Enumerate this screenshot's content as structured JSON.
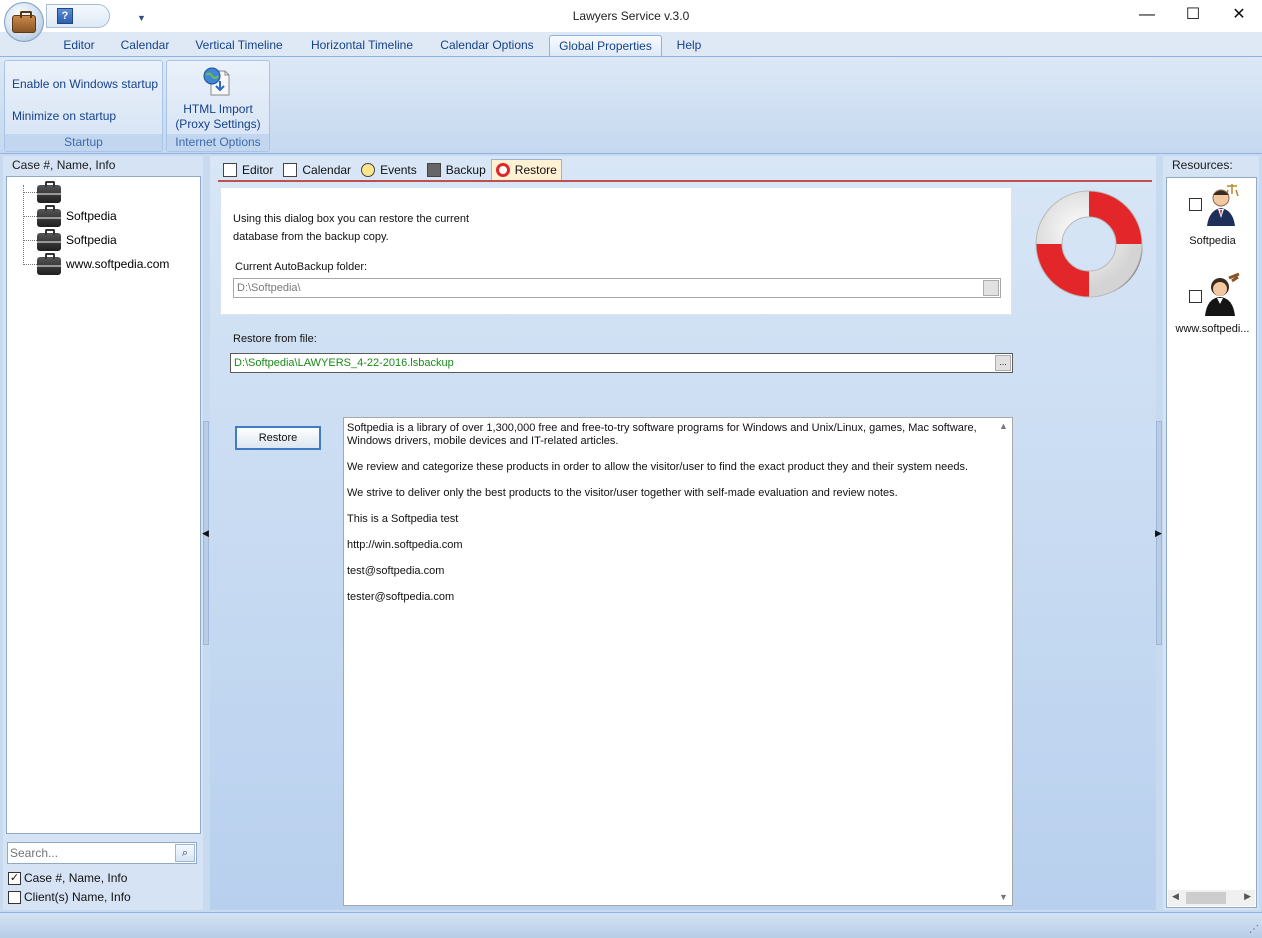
{
  "window": {
    "title": "Lawyers Service v.3.0",
    "min": "—",
    "max": "☐",
    "close": "✕",
    "help_glyph": "?",
    "qat_arrow": "▼"
  },
  "ribbon": {
    "tabs": [
      {
        "label": "Editor"
      },
      {
        "label": "Calendar"
      },
      {
        "label": "Vertical Timeline"
      },
      {
        "label": "Horizontal Timeline"
      },
      {
        "label": "Calendar Options"
      },
      {
        "label": "Global Properties"
      },
      {
        "label": "Help"
      }
    ],
    "active_tab": "Global Properties",
    "startup_group": {
      "label": "Startup",
      "enable_startup": "Enable on Windows startup",
      "minimize_startup": "Minimize on startup"
    },
    "internet_group": {
      "label": "Internet Options",
      "html_import_line1": "HTML Import",
      "html_import_line2": "(Proxy Settings)"
    }
  },
  "left_panel": {
    "header": "Case #, Name, Info",
    "tree_items": [
      {
        "label": ""
      },
      {
        "label": "Softpedia"
      },
      {
        "label": "Softpedia"
      },
      {
        "label": "www.softpedia.com"
      }
    ],
    "search_placeholder": "Search...",
    "search_btn": "⌕",
    "filter_case": {
      "label": "Case #, Name, Info",
      "checked": true
    },
    "filter_client": {
      "label": "Client(s) Name, Info",
      "checked": false
    }
  },
  "main": {
    "tabs": [
      {
        "label": "Editor"
      },
      {
        "label": "Calendar"
      },
      {
        "label": "Events"
      },
      {
        "label": "Backup"
      },
      {
        "label": "Restore"
      }
    ],
    "active_tab": "Restore",
    "description_line1": "Using this dialog box you can restore the current",
    "description_line2": "database from the backup copy.",
    "autobackup_label": "Current AutoBackup folder:",
    "autobackup_value": "D:\\Softpedia\\",
    "restore_from_label": "Restore from file:",
    "restore_from_value": "D:\\Softpedia\\LAWYERS_4-22-2016.lsbackup",
    "browse_btn": "...",
    "restore_button": "Restore",
    "notes": [
      "Softpedia is a library of over 1,300,000 free and free-to-try software programs for Windows and Unix/Linux, games, Mac software, Windows drivers, mobile devices and IT-related articles.",
      "We review and categorize these products in order to allow the visitor/user to find the exact product they and their system needs.",
      "We strive to deliver only the best products to the visitor/user together with self-made evaluation and review notes.",
      "This is a Softpedia test",
      "http://win.softpedia.com",
      "test@softpedia.com",
      "tester@softpedia.com"
    ]
  },
  "right_panel": {
    "header": "Resources:",
    "items": [
      {
        "label": "Softpedia"
      },
      {
        "label": "www.softpedi..."
      }
    ]
  },
  "colors": {
    "ribbon_text": "#15428b",
    "accent_line": "#c0504d",
    "path_green": "#1a8a1a"
  }
}
